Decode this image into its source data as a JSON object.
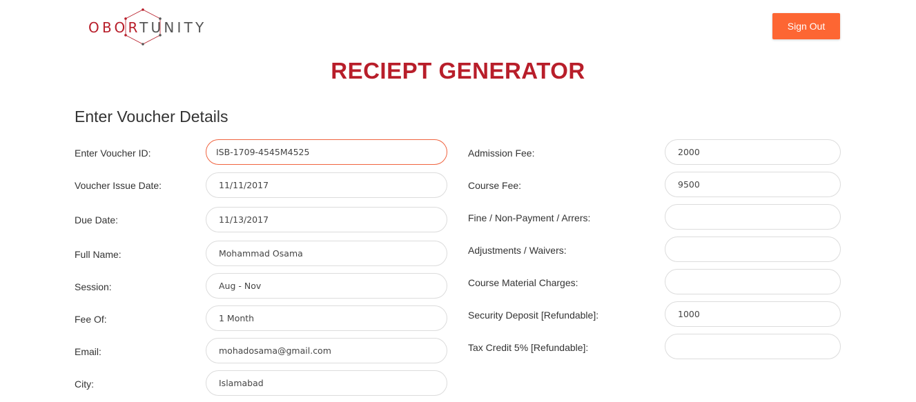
{
  "header": {
    "logo": {
      "part1": "OBOR",
      "part2": "TUNITY"
    },
    "sign_out_label": "Sign Out",
    "colors": {
      "brand_red": "#b81e2a",
      "accent_orange": "#fd6633"
    }
  },
  "page_title": "RECIEPT GENERATOR",
  "section_heading": "Enter Voucher Details",
  "left_fields": [
    {
      "label": "Enter Voucher ID:",
      "value": "ISB-1709-4545M4525",
      "focused": true
    },
    {
      "label": "Voucher Issue Date:",
      "value": "11/11/2017"
    },
    {
      "label": "Due Date:",
      "value": "11/13/2017"
    },
    {
      "label": "Full Name:",
      "value": "Mohammad Osama"
    },
    {
      "label": "Session:",
      "value": "Aug - Nov"
    },
    {
      "label": "Fee Of:",
      "value": "1 Month"
    },
    {
      "label": "Email:",
      "value": "mohadosama@gmail.com"
    },
    {
      "label": "City:",
      "value": "Islamabad"
    }
  ],
  "right_fields": [
    {
      "label": "Admission Fee:",
      "value": "2000"
    },
    {
      "label": "Course Fee:",
      "value": "9500"
    },
    {
      "label": "Fine / Non-Payment / Arrers:",
      "value": ""
    },
    {
      "label": "Adjustments / Waivers:",
      "value": ""
    },
    {
      "label": "Course Material Charges:",
      "value": ""
    },
    {
      "label": "Security Deposit [Refundable]:",
      "value": "1000"
    },
    {
      "label": "Tax Credit 5% [Refundable]:",
      "value": ""
    }
  ]
}
